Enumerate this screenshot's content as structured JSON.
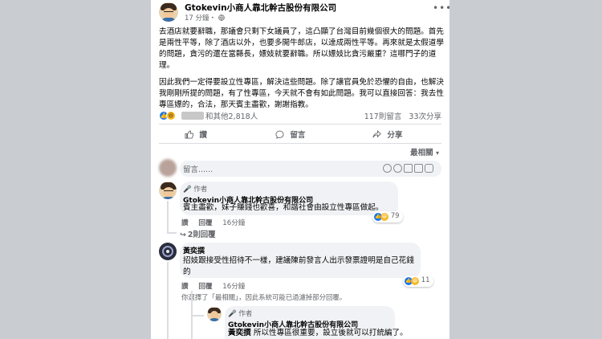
{
  "post": {
    "author": "Gtokevin小商人靠北幹古股份有限公司",
    "time": "17 分鐘・",
    "more_icon": "ellipsis-icon",
    "globe_icon": "globe-icon",
    "paragraph1": "去酒店就要辭職，那議會只剩下女議員了，這凸顯了台灣目前幾個很大的問題。首先是兩性平等，除了酒店以外，也要多開牛郎店，以達成兩性平等。再來就是太假道學的問題，貪污的還在當縣長，嫖妓就要辭職。所以嫖妓比貪污嚴重？這哪門子的道理。",
    "paragraph2": "因此我們一定得要設立性專區，解決這些問題。除了讓官員免於恐懼的自由，也解決我剛剛所提的問題，有了性專區，今天就不會有如此問題。我可以直接回答：我去性專區嫖的，合法，那天賓主盡歡，謝謝指教。"
  },
  "stats": {
    "reactions_text": "和其他2,818人",
    "comments": "117則留言",
    "shares": "33次分享"
  },
  "actions": {
    "like": "讚",
    "comment": "留言",
    "share": "分享"
  },
  "sort_label": "最相關",
  "comment_input": {
    "placeholder": "留言......"
  },
  "comments": [
    {
      "tag": "作者",
      "name": "Gtokevin小商人靠北幹古股份有限公司",
      "text": "賓主盡歡，妹子賺錢也歡喜，和諧社會由設立性專區做起。",
      "like": "讚",
      "reply": "回覆",
      "time": "16分鐘",
      "reactions": "79",
      "replies_link": "2則回覆"
    },
    {
      "name": "黃奕撰",
      "text": "招妓跟接受性招待不一樣，建議陳前發言人出示發票證明是自己花錢的",
      "like": "讚",
      "reply": "回覆",
      "time": "16分鐘",
      "reactions": "11"
    }
  ],
  "filter_note": "你選擇了「最相關」，因此系統可能已過濾掉部分回覆。",
  "reply": {
    "tag": "作者",
    "name": "Gtokevin小商人靠北幹古股份有限公司",
    "mention": "黃奕撰",
    "text": " 所以性專區很重要，設立後就可以打統編了。"
  }
}
